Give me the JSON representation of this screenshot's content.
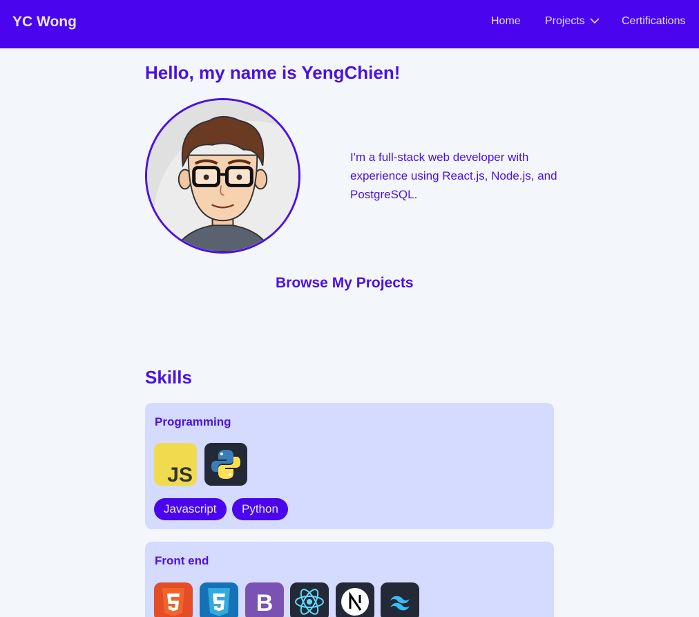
{
  "navbar": {
    "brand": "YC Wong",
    "links": [
      {
        "label": "Home"
      },
      {
        "label": "Projects"
      },
      {
        "label": "Certifications"
      }
    ]
  },
  "intro": {
    "greeting": "Hello, my name is YengChien!",
    "bio": "I'm a full-stack web developer with experience using React.js, Node.js, and PostgreSQL.",
    "browse_label": "Browse My Projects"
  },
  "skills": {
    "title": "Skills",
    "groups": [
      {
        "title": "Programming",
        "icons": [
          "javascript-icon",
          "python-icon"
        ],
        "tags": [
          "Javascript",
          "Python"
        ]
      },
      {
        "title": "Front end",
        "icons": [
          "html5-icon",
          "css3-icon",
          "bootstrap-icon",
          "react-icon",
          "nextjs-icon",
          "tailwind-icon"
        ],
        "tags": []
      }
    ]
  },
  "colors": {
    "accent": "#4a05ee",
    "text": "#4a11e6",
    "background": "#f3f6fb",
    "card": "#d5daff"
  }
}
